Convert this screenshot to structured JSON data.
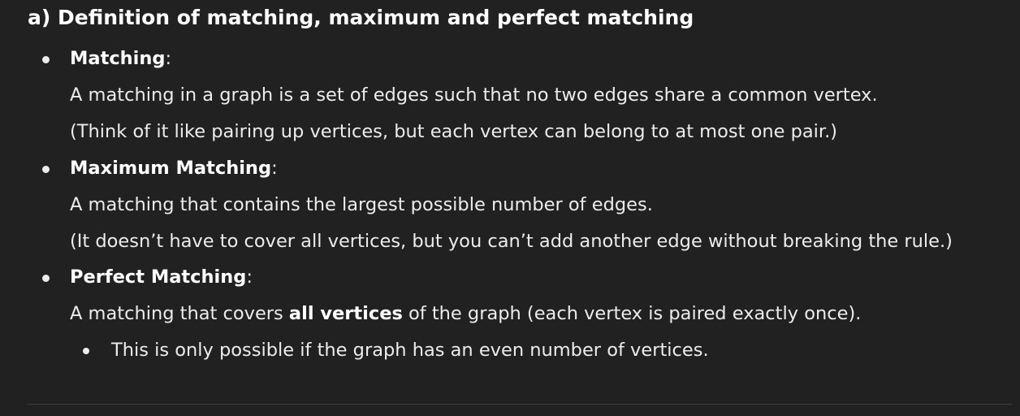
{
  "heading": "a) Definition of matching, maximum and perfect matching",
  "items": [
    {
      "term": "Matching",
      "colon": ":",
      "lines": [
        "A matching in a graph is a set of edges such that no two edges share a common vertex.",
        "(Think of it like pairing up vertices, but each vertex can belong to at most one pair.)"
      ]
    },
    {
      "term": "Maximum Matching",
      "colon": ":",
      "lines": [
        "A matching that contains the largest possible number of edges.",
        "(It doesn’t have to cover all vertices, but you can’t add another edge without breaking the rule.)"
      ]
    },
    {
      "term": "Perfect Matching",
      "colon": ":",
      "line_parts": {
        "before": "A matching that covers ",
        "bold": "all vertices",
        "after": " of the graph (each vertex is paired exactly once)."
      },
      "subitems": [
        "This is only possible if the graph has an even number of vertices."
      ]
    }
  ]
}
